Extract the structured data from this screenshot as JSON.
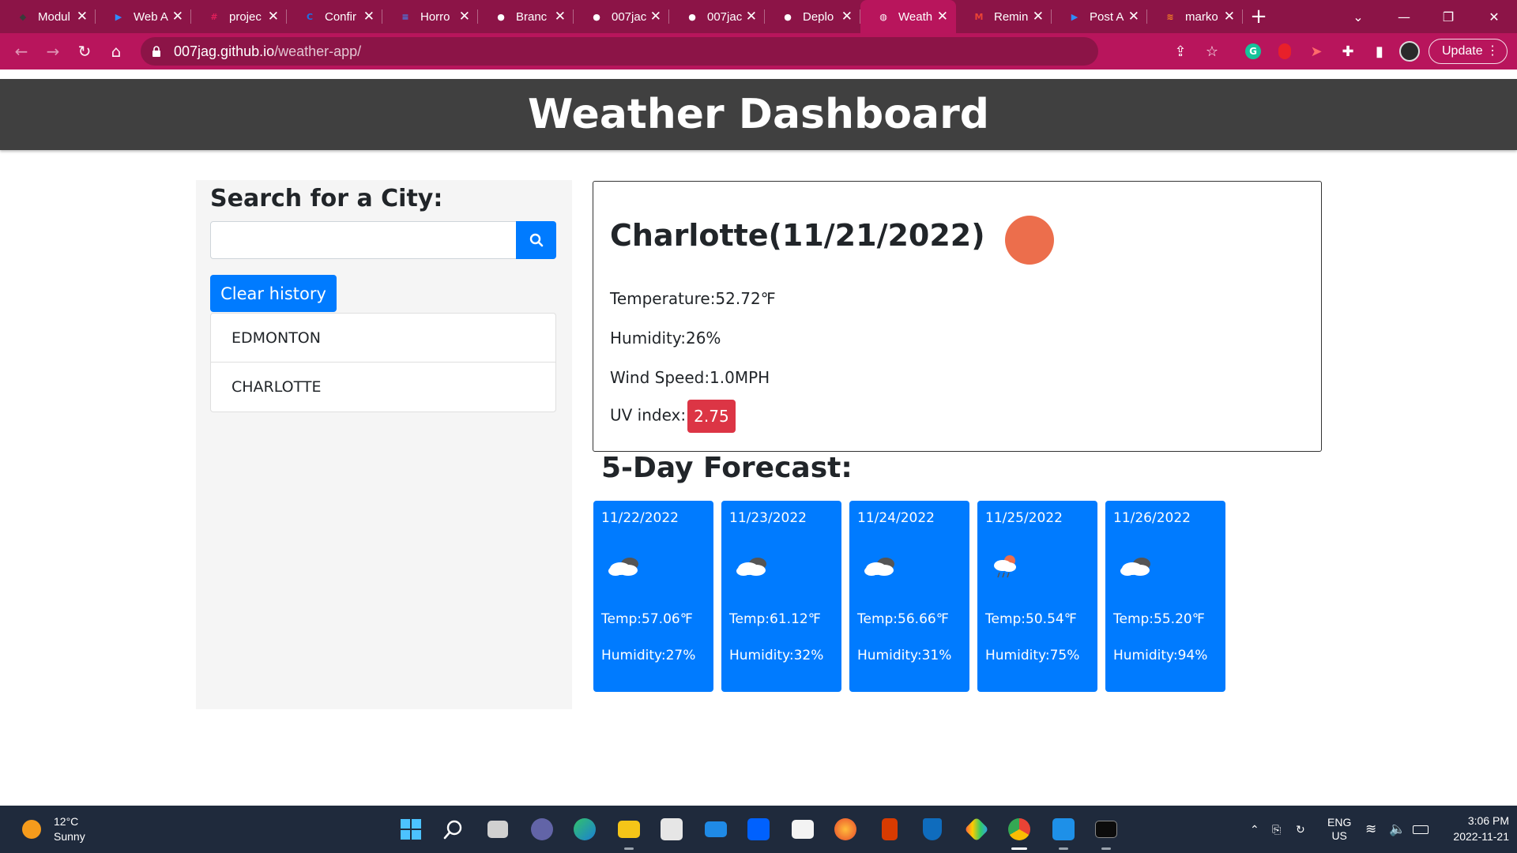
{
  "browser": {
    "tabs": [
      {
        "label": "Modul",
        "icon": "canvas-icon",
        "color": "#3a3a3a"
      },
      {
        "label": "Web A",
        "icon": "zoom-icon",
        "color": "#2d8cff"
      },
      {
        "label": "projec",
        "icon": "slack-icon",
        "color": "#e01e5a"
      },
      {
        "label": "Confir",
        "icon": "confirm-icon",
        "color": "#1a73e8"
      },
      {
        "label": "Horro",
        "icon": "docs-icon",
        "color": "#4285f4"
      },
      {
        "label": "Branc",
        "icon": "github-icon",
        "color": "#ffffff"
      },
      {
        "label": "007jac",
        "icon": "github-icon",
        "color": "#ffffff"
      },
      {
        "label": "007jac",
        "icon": "github-icon",
        "color": "#ffffff"
      },
      {
        "label": "Deplo",
        "icon": "github-icon",
        "color": "#ffffff"
      },
      {
        "label": "Weath",
        "icon": "globe-icon",
        "color": "#ffffff",
        "active": true
      },
      {
        "label": "Remin",
        "icon": "gmail-icon",
        "color": "#ea4335"
      },
      {
        "label": "Post A",
        "icon": "zoom-icon",
        "color": "#2d8cff"
      },
      {
        "label": "marko",
        "icon": "stackoverflow-icon",
        "color": "#f48024"
      }
    ],
    "url_host": "007jag.github.io",
    "url_path": "/weather-app/",
    "update_label": "Update",
    "chrome_color": "#b8155c"
  },
  "header": {
    "title": "Weather Dashboard"
  },
  "search": {
    "heading": "Search for a City:",
    "input_value": "",
    "input_placeholder": "",
    "clear_label": "Clear history",
    "history": [
      "EDMONTON",
      "CHARLOTTE"
    ]
  },
  "current": {
    "city_title": "Charlotte(11/21/2022)",
    "temperature": "Temperature:52.72℉",
    "humidity": "Humidity:26%",
    "wind": "Wind Speed:1.0MPH",
    "uv_label": "UV index:",
    "uv_value": "2.75",
    "icon": "sun-icon",
    "uv_color": "#dc3545"
  },
  "forecast": {
    "heading": "5-Day Forecast:",
    "days": [
      {
        "date": "11/22/2022",
        "icon": "broken-clouds-icon",
        "temp": "Temp:57.06℉",
        "humidity": "Humidity:27%"
      },
      {
        "date": "11/23/2022",
        "icon": "broken-clouds-icon",
        "temp": "Temp:61.12℉",
        "humidity": "Humidity:32%"
      },
      {
        "date": "11/24/2022",
        "icon": "broken-clouds-icon",
        "temp": "Temp:56.66℉",
        "humidity": "Humidity:31%"
      },
      {
        "date": "11/25/2022",
        "icon": "light-rain-icon",
        "temp": "Temp:50.54℉",
        "humidity": "Humidity:75%"
      },
      {
        "date": "11/26/2022",
        "icon": "broken-clouds-icon",
        "temp": "Temp:55.20℉",
        "humidity": "Humidity:94%"
      }
    ],
    "card_color": "#007bff"
  },
  "taskbar": {
    "weather_temp": "12°C",
    "weather_desc": "Sunny",
    "lang_top": "ENG",
    "lang_bottom": "US",
    "time": "3:06 PM",
    "date": "2022-11-21"
  }
}
